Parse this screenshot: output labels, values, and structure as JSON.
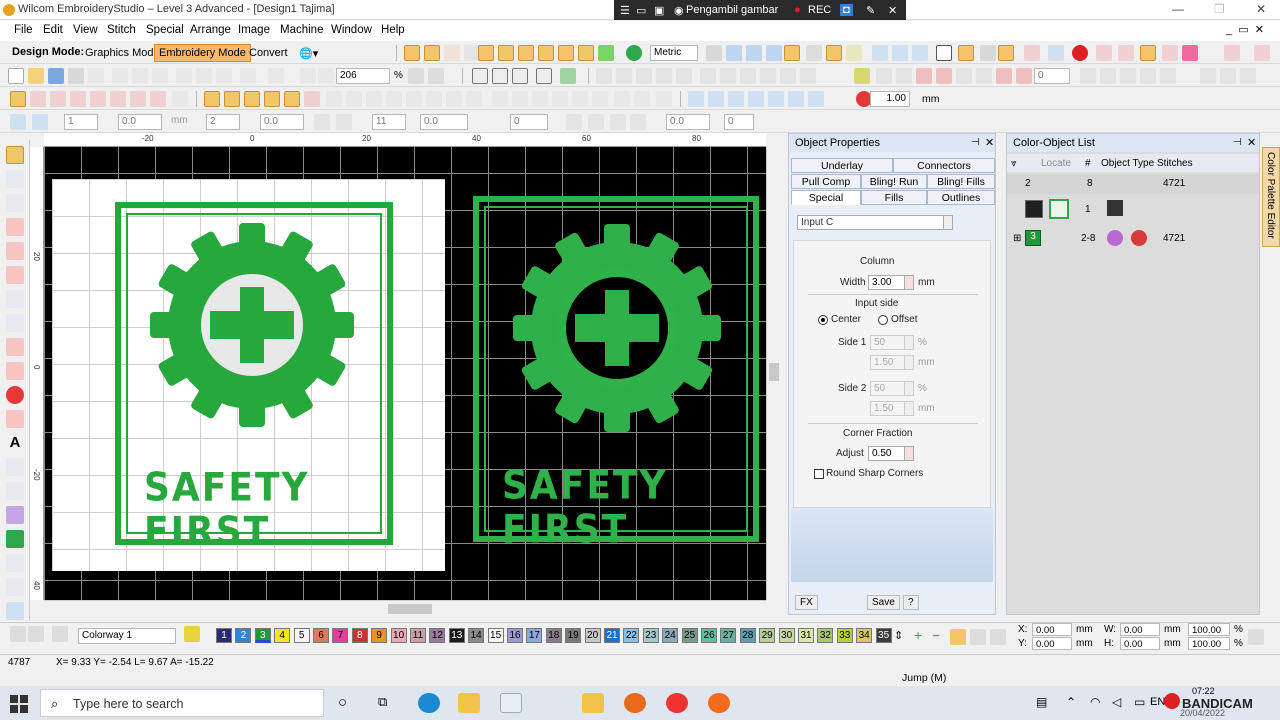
{
  "window": {
    "title": "Wilcom EmbroideryStudio – Level 3 Advanced - [Design1      Tajima]",
    "recorder": {
      "label": "Pengambil gambar",
      "rec": "REC"
    }
  },
  "menu": [
    "File",
    "Edit",
    "View",
    "Stitch",
    "Special",
    "Arrange",
    "Image",
    "Machine",
    "Window",
    "Help"
  ],
  "toolbar": {
    "design_mode_label": "Design Mode:",
    "graphics_mode": "Graphics Mode",
    "embroidery_mode": "Embroidery Mode",
    "convert": "Convert",
    "units": "Metric",
    "zoom": "206",
    "zoom_unit": "%",
    "spacing": "1.00",
    "spacing_unit": "mm",
    "fields": [
      "1",
      "0.0",
      "0.0",
      "mm",
      "2",
      "0.0",
      "0.0",
      "11",
      "0.0",
      "0",
      "0.0",
      "0",
      "0"
    ]
  },
  "ruler": {
    "top": [
      "-20",
      "0",
      "20",
      "40",
      "60",
      "80"
    ],
    "left": [
      "20",
      "0",
      "-20",
      "40"
    ]
  },
  "design": {
    "left_text": "SAFETY FIRST",
    "right_text": "SAFETY FIRST"
  },
  "object_properties": {
    "title": "Object Properties",
    "tabs_row1": [
      "Underlay",
      "Connectors"
    ],
    "tabs_row2": [
      "Pull Comp",
      "Bling! Run",
      "Bling! Fills"
    ],
    "tabs_row3": [
      "Special",
      "Fills",
      "Outlines"
    ],
    "input_method": "Input C",
    "column_label": "Column",
    "width_label": "Width",
    "width_value": "3.00",
    "width_unit": "mm",
    "input_side_label": "Input side",
    "center_label": "Center",
    "offset_label": "Offset",
    "side1_label": "Side 1",
    "side1_pct": "50",
    "side1_mm": "1.50",
    "side2_label": "Side 2",
    "side2_pct": "50",
    "side2_mm": "1.50",
    "pct_unit": "%",
    "mm_unit": "mm",
    "corner_fraction_label": "Corner Fraction",
    "adjust_label": "Adjust",
    "adjust_value": "0.50",
    "round_corners_label": "Round Sharp Corners",
    "fx_button": "FX",
    "save_button": "Save",
    "help_button": "?"
  },
  "color_object_list": {
    "title": "Color-Object List",
    "headers": {
      "locate": "Locate",
      "num": "#",
      "type": "Object Type",
      "stitches": "Stitches"
    },
    "row1": {
      "col": "2",
      "num": "8",
      "stitches": "4721"
    },
    "row2": {
      "num": "1"
    },
    "row3": {
      "col": "3",
      "num": "2-8",
      "stitches": "4721"
    }
  },
  "palette_tab": "Color Palette Editor",
  "colorbar": {
    "colorway": "Colorway 1",
    "swatches": [
      {
        "n": "1",
        "c": "#2a2a7a",
        "fg": "#fff"
      },
      {
        "n": "2",
        "c": "#2f84d4",
        "fg": "#fff"
      },
      {
        "n": "3",
        "c": "#1e9a3a",
        "fg": "#fff"
      },
      {
        "n": "4",
        "c": "#f2e81c",
        "fg": "#000"
      },
      {
        "n": "5",
        "c": "#f4f4f4",
        "fg": "#000"
      },
      {
        "n": "6",
        "c": "#e07a5a",
        "fg": "#000"
      },
      {
        "n": "7",
        "c": "#e0409a",
        "fg": "#000"
      },
      {
        "n": "8",
        "c": "#c33",
        "fg": "#fff"
      },
      {
        "n": "9",
        "c": "#e8961e",
        "fg": "#000"
      },
      {
        "n": "10",
        "c": "#e8a8b8",
        "fg": "#000"
      },
      {
        "n": "11",
        "c": "#c9a0a8",
        "fg": "#000"
      },
      {
        "n": "12",
        "c": "#9a7a9a",
        "fg": "#000"
      },
      {
        "n": "13",
        "c": "#1a1a1a",
        "fg": "#fff"
      },
      {
        "n": "14",
        "c": "#8a8a8a",
        "fg": "#000"
      },
      {
        "n": "15",
        "c": "#f8f8f8",
        "fg": "#000"
      },
      {
        "n": "16",
        "c": "#9a9ad0",
        "fg": "#000"
      },
      {
        "n": "17",
        "c": "#8aa8d8",
        "fg": "#000"
      },
      {
        "n": "18",
        "c": "#8a7a8a",
        "fg": "#000"
      },
      {
        "n": "19",
        "c": "#7a7a7a",
        "fg": "#000"
      },
      {
        "n": "20",
        "c": "#c8c8c8",
        "fg": "#000"
      },
      {
        "n": "21",
        "c": "#1d6fd0",
        "fg": "#fff"
      },
      {
        "n": "22",
        "c": "#8ac0e8",
        "fg": "#000"
      },
      {
        "n": "23",
        "c": "#a8c8c8",
        "fg": "#000"
      },
      {
        "n": "24",
        "c": "#8aa8b8",
        "fg": "#000"
      },
      {
        "n": "25",
        "c": "#7a9a8a",
        "fg": "#000"
      },
      {
        "n": "26",
        "c": "#5ac0a0",
        "fg": "#000"
      },
      {
        "n": "27",
        "c": "#6ab0a0",
        "fg": "#000"
      },
      {
        "n": "28",
        "c": "#5aa0b0",
        "fg": "#000"
      },
      {
        "n": "29",
        "c": "#b8d098",
        "fg": "#000"
      },
      {
        "n": "30",
        "c": "#c8d8a0",
        "fg": "#000"
      },
      {
        "n": "31",
        "c": "#d8e8a8",
        "fg": "#000"
      },
      {
        "n": "32",
        "c": "#a8c870",
        "fg": "#000"
      },
      {
        "n": "33",
        "c": "#b8d030",
        "fg": "#000"
      },
      {
        "n": "34",
        "c": "#d8c860",
        "fg": "#000"
      },
      {
        "n": "35",
        "c": "#3a3a3a",
        "fg": "#fff"
      }
    ],
    "coords": {
      "x_label": "X:",
      "x": "0.00",
      "y_label": "Y:",
      "y": "0.00",
      "w_label": "W:",
      "w": "0.00",
      "h_label": "H:",
      "h": "0.00",
      "unit": "mm",
      "wpct": "100.00",
      "hpct": "100.00",
      "pct": "%"
    }
  },
  "status": {
    "stitch_count": "4787",
    "coords": "X=   9.33 Y=  -2.54 L=   9.67 A= -15.22",
    "mode": "Jump (M)"
  },
  "taskbar": {
    "search_placeholder": "Type here to search",
    "lang": "EN",
    "bandicam": "BANDICAM",
    "time": "07:22",
    "date": "20/04/2022"
  }
}
